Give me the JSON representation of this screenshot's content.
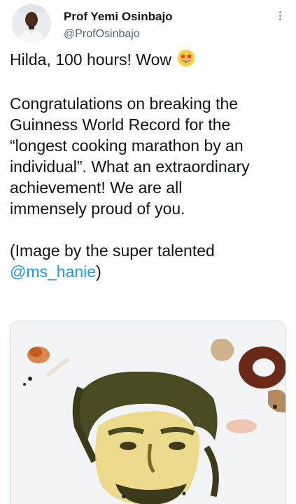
{
  "tweet": {
    "author_name": "Prof Yemi Osinbajo",
    "author_handle": "@ProfOsinbajo",
    "line1": "Hilda, 100 hours! Wow",
    "line1_emoji": "star-struck-emoji",
    "paragraph2": [
      "Congratulations on breaking the",
      "Guinness World Record for the",
      "“longest cooking marathon by an",
      "individual”. What an extraordinary",
      "achievement! We are all",
      "immensely proud of you."
    ],
    "paragraph3_line1": "(Image by the super talented",
    "mention": "@ms_hanie",
    "mention_suffix": ")"
  },
  "media": {
    "description_icon": "food-portrait-image"
  },
  "colors": {
    "text": "#0f1419",
    "secondary": "#536471",
    "link": "#1d9bf0"
  }
}
